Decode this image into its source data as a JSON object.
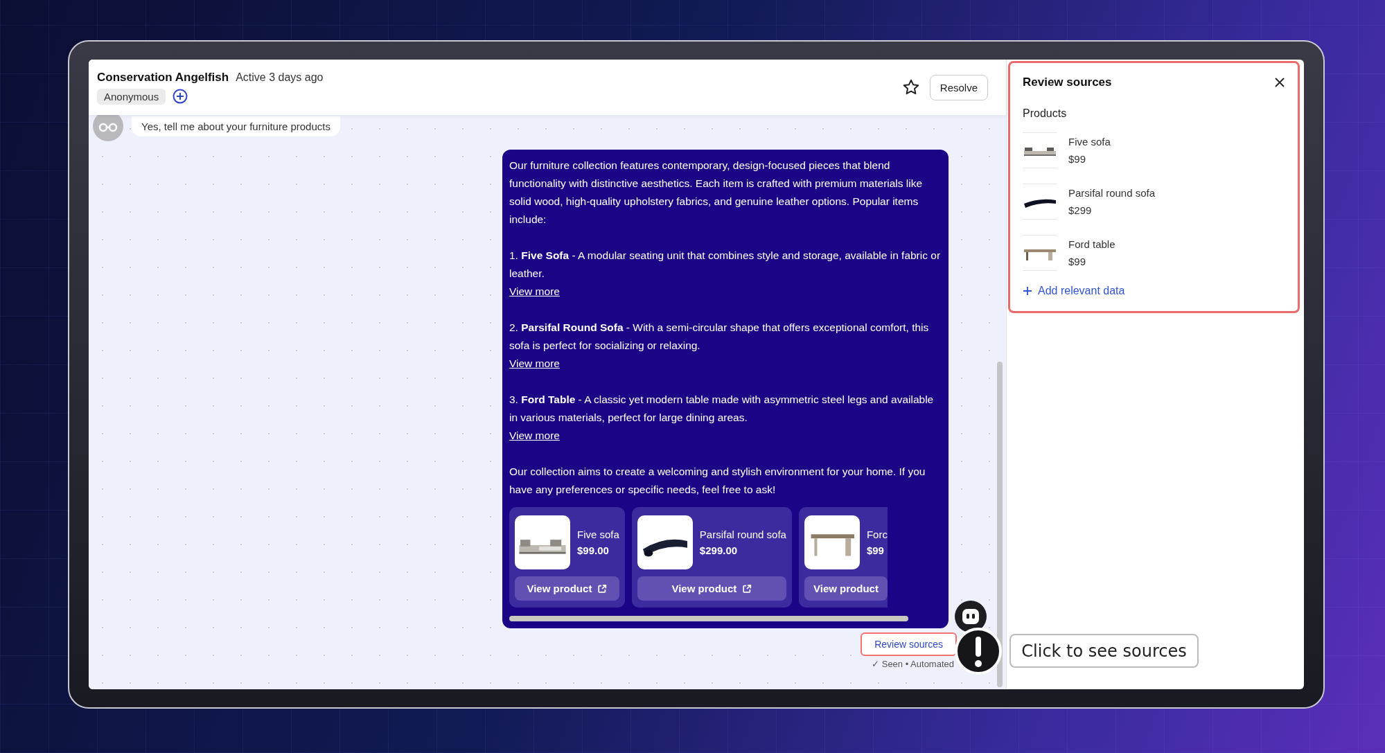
{
  "header": {
    "name": "Conservation Angelfish",
    "status": "Active 3 days ago",
    "tag": "Anonymous",
    "resolve": "Resolve"
  },
  "user_message": {
    "text": "Yes, tell me about your furniture products"
  },
  "bot_message": {
    "intro": "Our furniture collection features contemporary, design-focused pieces that blend functionality with distinctive aesthetics. Each item is crafted with premium materials like solid wood, high-quality upholstery fabrics, and genuine leather options. Popular items include:",
    "items": [
      {
        "text": "1. **Five Sofa** - A modular seating unit that combines style and storage, available in fabric or leather.",
        "link": "View more"
      },
      {
        "text": "2. **Parsifal Round Sofa** - With a semi-circular shape that offers exceptional comfort, this sofa is perfect for socializing or relaxing.",
        "link": "View more"
      },
      {
        "text": "3. **Ford Table** - A classic yet modern table made with asymmetric steel legs and available in various materials, perfect for large dining areas.",
        "link": "View more"
      }
    ],
    "outro": "Our collection aims to create a welcoming and stylish environment for your home. If you have any preferences or specific needs, feel free to ask!",
    "products": [
      {
        "name": "Five sofa",
        "price": "$99.00",
        "button": "View product",
        "external_icon": true
      },
      {
        "name": "Parsifal round sofa",
        "price": "$299.00",
        "button": "View product",
        "external_icon": true
      },
      {
        "name": "Forc",
        "price": "$99",
        "button": "View product",
        "external_icon": false
      }
    ]
  },
  "review_button": "Review sources",
  "seen": "✓ Seen • Automated",
  "tooltip": "Click to see sources",
  "panel": {
    "title": "Review sources",
    "section": "Products",
    "items": [
      {
        "name": "Five sofa",
        "price": "$99"
      },
      {
        "name": "Parsifal round sofa",
        "price": "$299"
      },
      {
        "name": "Ford table",
        "price": "$99"
      }
    ],
    "add": "Add relevant data"
  }
}
